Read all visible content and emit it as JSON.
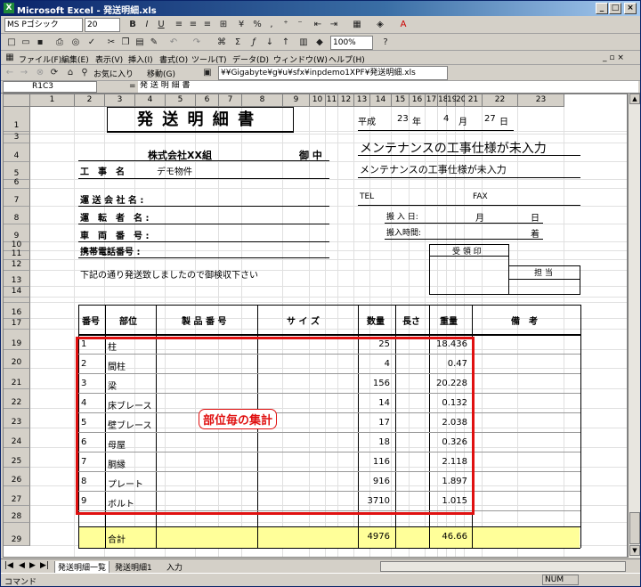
{
  "window": {
    "title": "Microsoft Excel - 発送明細.xls",
    "minimize": "_",
    "maximize": "□",
    "close": "×"
  },
  "format_bar": {
    "font_name": "MS Pゴシック",
    "font_size": "20",
    "bold": "B",
    "italic": "I",
    "underline": "U",
    "percent": "%",
    "comma": ",",
    "zoom": "100%"
  },
  "menu": {
    "items": [
      "ファイル(F)",
      "編集(E)",
      "表示(V)",
      "挿入(I)",
      "書式(O)",
      "ツール(T)",
      "データ(D)",
      "ウィンドウ(W)",
      "ヘルプ(H)"
    ]
  },
  "web_bar": {
    "favorites": "お気に入り",
    "goto": "移動(G)",
    "address": "¥¥Gigabyte¥g¥u¥sfx¥inpdemo1XPF¥発送明細.xls"
  },
  "formula_bar": {
    "name_box": "R1C3",
    "equals": "=",
    "content": "発 送 明 細 書"
  },
  "columns": [
    "1",
    "2",
    "3",
    "4",
    "5",
    "6",
    "7",
    "8",
    "9",
    "10",
    "11",
    "12",
    "13",
    "14",
    "15",
    "16",
    "17",
    "18",
    "19",
    "20",
    "21",
    "22",
    "23"
  ],
  "rows": [
    "1",
    "2",
    "3",
    "4",
    "5",
    "6",
    "7",
    "8",
    "9",
    "10",
    "11",
    "12",
    "13",
    "14",
    "15",
    "16",
    "17",
    "19",
    "20",
    "21",
    "22",
    "23",
    "24",
    "25",
    "26",
    "27",
    "28",
    "29"
  ],
  "form": {
    "title": "発 送 明 細 書",
    "era": "平成",
    "year": "23",
    "year_unit": "年",
    "month": "4",
    "month_unit": "月",
    "day": "27",
    "day_unit": "日",
    "company": "株式会社XX組",
    "onchu": "御 中",
    "koji_label": "工　事　名",
    "koji_value": "デモ物件",
    "spec_warning_large": "メンテナンスの工事仕様が未入力",
    "spec_warning_small": "メンテナンスの工事仕様が未入力",
    "carrier_label": "運 送 会 社 名 :",
    "driver_label": "運　転　者　名 :",
    "vehicle_label": "車　両　番　号 :",
    "mobile_label": "携帯電話番号 :",
    "tel_label": "TEL",
    "fax_label": "FAX",
    "carry_date_label": "搬 入 日:",
    "carry_month": "月",
    "carry_day": "日",
    "carry_time_label": "搬入時間:",
    "carry_no": "着",
    "receipt_label": "受 領 印",
    "tanto_label": "担 当",
    "message": "下記の通り発送致しましたので御検収下さい"
  },
  "table": {
    "headers": {
      "no": "番号",
      "part": "部位",
      "product_no": "製 品 番 号",
      "size": "サ イ ズ",
      "qty": "数量",
      "length": "長さ",
      "weight": "重量",
      "remarks": "備　考"
    },
    "rows": [
      {
        "no": "1",
        "part": "柱",
        "qty": "25",
        "weight": "18.436"
      },
      {
        "no": "2",
        "part": "間柱",
        "qty": "4",
        "weight": "0.47"
      },
      {
        "no": "3",
        "part": "梁",
        "qty": "156",
        "weight": "20.228"
      },
      {
        "no": "4",
        "part": "床ブレース",
        "qty": "14",
        "weight": "0.132"
      },
      {
        "no": "5",
        "part": "壁ブレース",
        "qty": "17",
        "weight": "2.038"
      },
      {
        "no": "6",
        "part": "母屋",
        "qty": "18",
        "weight": "0.326"
      },
      {
        "no": "7",
        "part": "胴縁",
        "qty": "116",
        "weight": "2.118"
      },
      {
        "no": "8",
        "part": "プレート",
        "qty": "916",
        "weight": "1.897"
      },
      {
        "no": "9",
        "part": "ボルト",
        "qty": "3710",
        "weight": "1.015"
      }
    ],
    "total_label": "合計",
    "total_qty": "4976",
    "total_weight": "46.66"
  },
  "annotation": "部位毎の集計",
  "sheet_tabs": [
    "発送明細一覧",
    "発送明細1",
    "入力"
  ],
  "status": {
    "mode": "コマンド",
    "num": "NUM"
  },
  "colors": {
    "annotation_red": "#e01010",
    "total_row_fill": "#ffff99",
    "titlebar": "#0a246a"
  }
}
